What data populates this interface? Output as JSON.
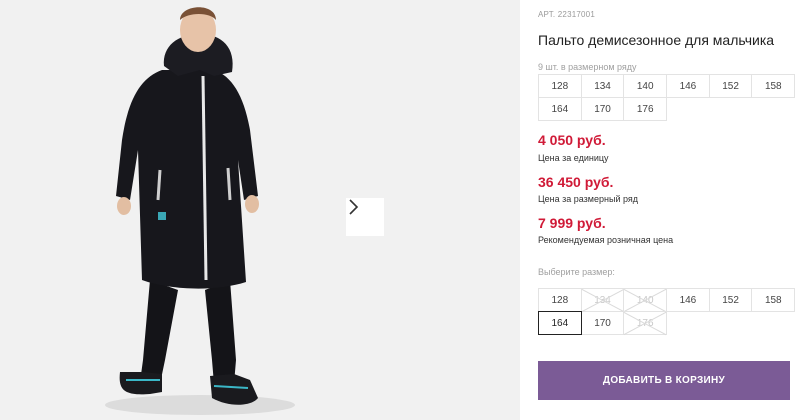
{
  "product": {
    "article_label": "АРТ.",
    "article": "22317001",
    "title": "Пальто демисезонное для мальчика"
  },
  "gallery": {
    "next_icon": "chevron-right-icon"
  },
  "size_grid": {
    "caption": "9 шт. в размерном ряду",
    "sizes": [
      "128",
      "134",
      "140",
      "146",
      "152",
      "158",
      "164",
      "170",
      "176"
    ]
  },
  "prices": {
    "unit_price": "4 050 руб.",
    "unit_label": "Цена за единицу",
    "grid_price": "36 450 руб.",
    "grid_label": "Цена за размерный ряд",
    "retail_price": "7 999 руб.",
    "retail_label": "Рекомендуемая розничная цена"
  },
  "size_picker": {
    "caption": "Выберите размер:",
    "sizes": [
      {
        "label": "128",
        "state": "available"
      },
      {
        "label": "134",
        "state": "disabled"
      },
      {
        "label": "140",
        "state": "disabled"
      },
      {
        "label": "146",
        "state": "available"
      },
      {
        "label": "152",
        "state": "available"
      },
      {
        "label": "158",
        "state": "available"
      },
      {
        "label": "164",
        "state": "selected"
      },
      {
        "label": "170",
        "state": "available"
      },
      {
        "label": "176",
        "state": "disabled"
      }
    ]
  },
  "cart": {
    "button_label": "ДОБАВИТЬ В КОРЗИНУ"
  },
  "colors": {
    "price": "#d01a37",
    "button": "#7b5b96"
  }
}
